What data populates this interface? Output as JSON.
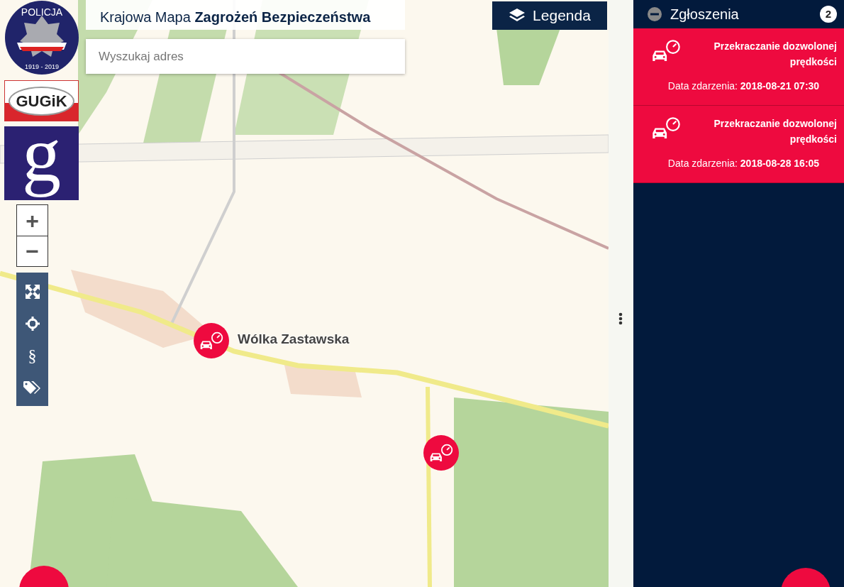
{
  "logos": {
    "police": {
      "top_text": "POLICJA",
      "bottom_text": "1919 - 2019"
    },
    "gugik": {
      "text": "GUGiK"
    },
    "geoportal": {
      "text": "g"
    }
  },
  "header": {
    "title": "Krajowa Mapa **Zagrożeń Bezpieczeństwa**"
  },
  "search": {
    "placeholder": "Wyszukaj adres"
  },
  "legend_button": {
    "label": "Legenda"
  },
  "zoom": {
    "in_label": "+",
    "out_label": "−"
  },
  "tools": [
    {
      "kind": "fullscreen"
    },
    {
      "kind": "locate"
    },
    {
      "kind": "text",
      "label": "§"
    },
    {
      "kind": "tags"
    }
  ],
  "map": {
    "place_label": "Wólka Zastawska",
    "markers": [
      {
        "kind": "speeding"
      },
      {
        "kind": "speeding"
      }
    ]
  },
  "panel": {
    "title": "Zgłoszenia",
    "count": "2",
    "expanded": true,
    "reports": [
      {
        "kind": "speeding",
        "title": "Przekraczanie dozwolonej prędkości",
        "date_line": "Data zdarzenia: **2018-08-21 07:30**"
      },
      {
        "kind": "speeding",
        "title": "Przekraczanie dozwolonej prędkości",
        "date_line": "Data zdarzenia: **2018-08-28 16:05**"
      }
    ]
  }
}
